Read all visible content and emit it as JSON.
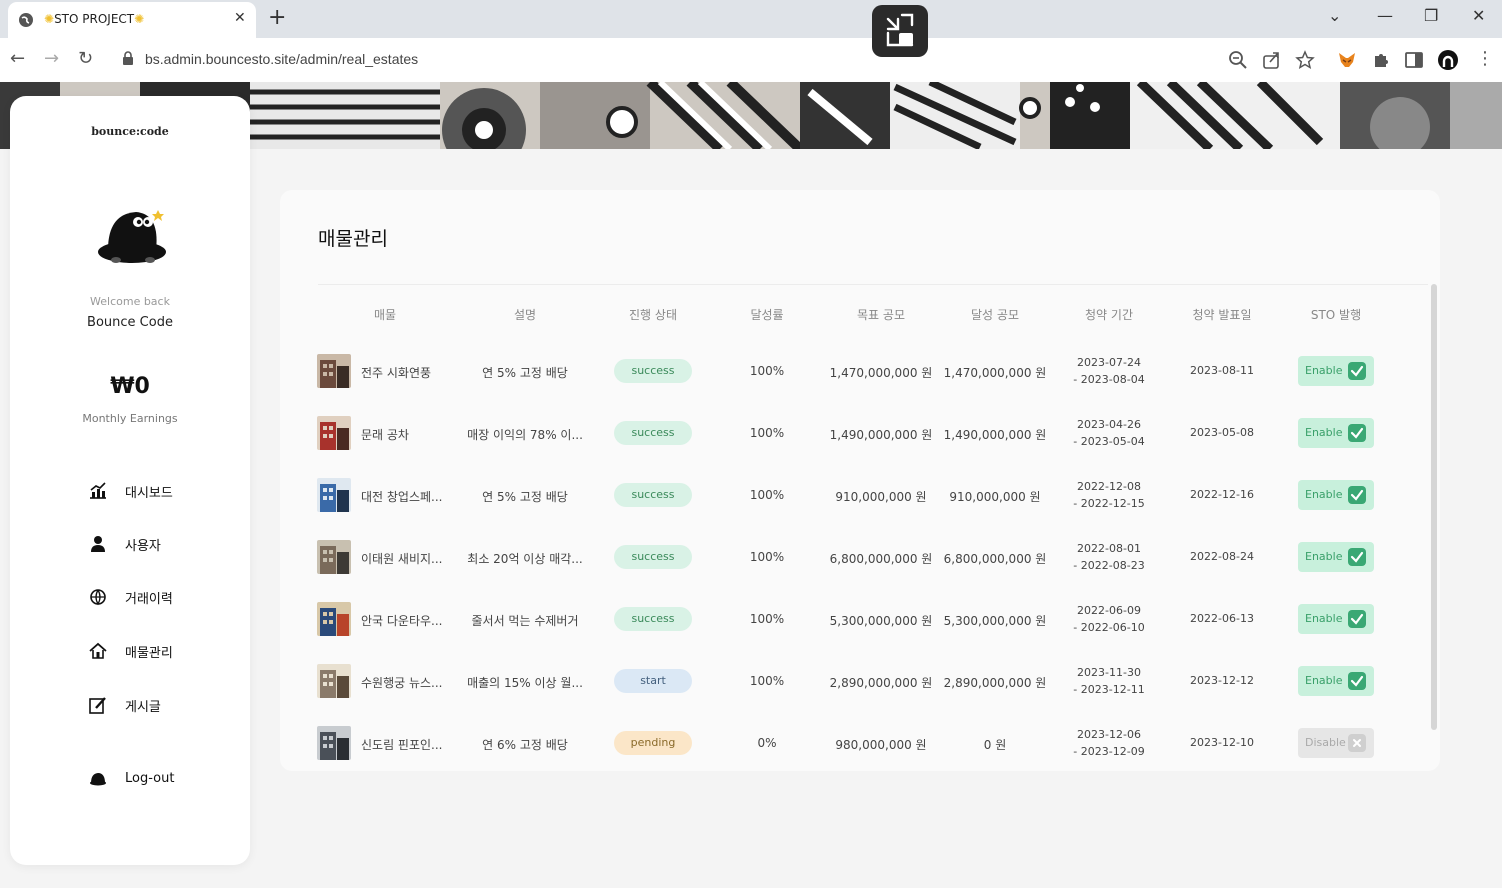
{
  "browser": {
    "tab_title": "STO PROJECT",
    "url": "bs.admin.bouncesto.site/admin/real_estates"
  },
  "sidebar": {
    "logo": "bounce:code",
    "welcome": "Welcome back",
    "username": "Bounce Code",
    "earnings": "₩0",
    "earnings_label": "Monthly Earnings",
    "menu": [
      {
        "label": "대시보드",
        "icon": "chart-icon"
      },
      {
        "label": "사용자",
        "icon": "user-icon"
      },
      {
        "label": "거래이력",
        "icon": "globe-icon"
      },
      {
        "label": "매물관리",
        "icon": "house-icon"
      },
      {
        "label": "게시글",
        "icon": "edit-icon"
      }
    ],
    "logout": "Log-out"
  },
  "main": {
    "title": "매물관리",
    "columns": [
      "매물",
      "설명",
      "진행 상태",
      "달성률",
      "목표 공모",
      "달성 공모",
      "청약 기간",
      "청약 발표일",
      "STO 발행"
    ],
    "rows": [
      {
        "name": "전주 시화연풍",
        "desc": "연 5% 고정 배당",
        "status": "success",
        "rate": "100%",
        "target": "1,470,000,000 원",
        "achieved": "1,470,000,000 원",
        "period_start": "2023-07-24",
        "period_end": "- 2023-08-04",
        "announce": "2023-08-11",
        "sto": "Enable"
      },
      {
        "name": "문래 공차",
        "desc": "매장 이익의 78% 이...",
        "status": "success",
        "rate": "100%",
        "target": "1,490,000,000 원",
        "achieved": "1,490,000,000 원",
        "period_start": "2023-04-26",
        "period_end": "- 2023-05-04",
        "announce": "2023-05-08",
        "sto": "Enable"
      },
      {
        "name": "대전 창업스페...",
        "desc": "연 5% 고정 배당",
        "status": "success",
        "rate": "100%",
        "target": "910,000,000 원",
        "achieved": "910,000,000 원",
        "period_start": "2022-12-08",
        "period_end": "- 2022-12-15",
        "announce": "2022-12-16",
        "sto": "Enable"
      },
      {
        "name": "이태원 새비지...",
        "desc": "최소 20억 이상 매각...",
        "status": "success",
        "rate": "100%",
        "target": "6,800,000,000 원",
        "achieved": "6,800,000,000 원",
        "period_start": "2022-08-01",
        "period_end": "- 2022-08-23",
        "announce": "2022-08-24",
        "sto": "Enable"
      },
      {
        "name": "안국 다운타우...",
        "desc": "줄서서 먹는 수제버거",
        "status": "success",
        "rate": "100%",
        "target": "5,300,000,000 원",
        "achieved": "5,300,000,000 원",
        "period_start": "2022-06-09",
        "period_end": "- 2022-06-10",
        "announce": "2022-06-13",
        "sto": "Enable"
      },
      {
        "name": "수원행궁 뉴스...",
        "desc": "매출의 15% 이상 월...",
        "status": "start",
        "rate": "100%",
        "target": "2,890,000,000 원",
        "achieved": "2,890,000,000 원",
        "period_start": "2023-11-30",
        "period_end": "- 2023-12-11",
        "announce": "2023-12-12",
        "sto": "Enable"
      },
      {
        "name": "신도림 핀포인...",
        "desc": "연 6% 고정 배당",
        "status": "pending",
        "rate": "0%",
        "target": "980,000,000 원",
        "achieved": "0 원",
        "period_start": "2023-12-06",
        "period_end": "- 2023-12-09",
        "announce": "2023-12-10",
        "sto": "Disable"
      }
    ]
  },
  "colors": {
    "success_bg": "#d9f2e6",
    "success_fg": "#3a8a5a",
    "start_bg": "#dbe8f5",
    "start_fg": "#44607e",
    "pending_bg": "#fbe6c8",
    "pending_fg": "#8a6a2a",
    "enable_bg": "#c8f0dc",
    "enable_fg": "#3aa06a",
    "enable_box": "#3aa874",
    "disable_bg": "#e6e6e6",
    "disable_fg": "#aaaaaa",
    "disable_box": "#cfcfcf"
  }
}
